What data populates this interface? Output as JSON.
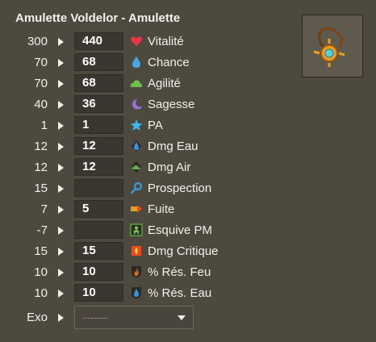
{
  "item": {
    "title": "Amulette Voldelor - Amulette",
    "image_icon": "amulet-icon"
  },
  "stats": [
    {
      "base": "300",
      "value": "440",
      "label": "Vitalité",
      "icon": "heart-icon",
      "color": "#e8344a"
    },
    {
      "base": "70",
      "value": "68",
      "label": "Chance",
      "icon": "water-drop-icon",
      "color": "#47a7e8"
    },
    {
      "base": "70",
      "value": "68",
      "label": "Agilité",
      "icon": "cloud-icon",
      "color": "#6cc24a"
    },
    {
      "base": "40",
      "value": "36",
      "label": "Sagesse",
      "icon": "moon-icon",
      "color": "#9a6fe0"
    },
    {
      "base": "1",
      "value": "1",
      "label": "PA",
      "icon": "star-icon",
      "color": "#3bb8e8"
    },
    {
      "base": "12",
      "value": "12",
      "label": "Dmg Eau",
      "icon": "water-damage-icon",
      "color": "#3a8fd9"
    },
    {
      "base": "12",
      "value": "12",
      "label": "Dmg Air",
      "icon": "air-damage-icon",
      "color": "#5bb04a"
    },
    {
      "base": "15",
      "value": "",
      "label": "Prospection",
      "icon": "magnifier-icon",
      "color": "#3a9ad9"
    },
    {
      "base": "7",
      "value": "5",
      "label": "Fuite",
      "icon": "escape-icon",
      "color": "#e8a020"
    },
    {
      "base": "-7",
      "value": "",
      "label": "Esquive PM",
      "icon": "dodge-icon",
      "color": "#5aa03a"
    },
    {
      "base": "15",
      "value": "15",
      "label": "Dmg Critique",
      "icon": "critical-icon",
      "color": "#e84a20"
    },
    {
      "base": "10",
      "value": "10",
      "label": "% Rés. Feu",
      "icon": "fire-resist-icon",
      "color": "#e8701a"
    },
    {
      "base": "10",
      "value": "10",
      "label": "% Rés. Eau",
      "icon": "water-resist-icon",
      "color": "#3a8fd9"
    }
  ],
  "exo": {
    "label": "Exo",
    "selected": "-------"
  }
}
